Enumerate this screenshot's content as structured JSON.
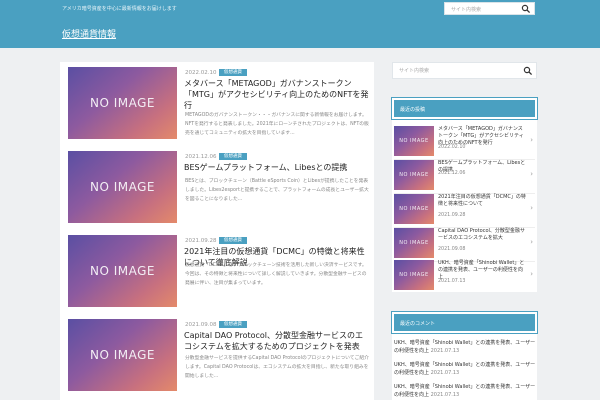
{
  "header": {
    "tagline": "アメリカ暗号資産を中心に最新情報をお届けします",
    "site_title": "仮想通貨情報",
    "search_placeholder": "サイト内検索"
  },
  "posts": [
    {
      "thumb_text": "NO IMAGE",
      "date": "2022.02.10",
      "category": "仮想通貨",
      "title": "メタバース「METAGOD」ガバナンストークン「MTG」がアクセシビリティ向上のためのNFTを発行",
      "excerpt": "METAGODのガバナンストークン・・・ガバナンスに関する新情報をお届けします。NFTを発行すると発表しました。2021年にローンチされたプロジェクトは、NFTの販売を通じてコミュニティの拡大を目指しています..."
    },
    {
      "thumb_text": "NO IMAGE",
      "date": "2021.12.06",
      "category": "仮想通貨",
      "title": "BESゲームプラットフォーム、Libesとの提携",
      "excerpt": "BESとは、ブロックチェーン（Battle eSports Coin）とLibesが提携したことを発表しました。Libes2esportと提携することで、プラットフォームの成長とユーザー拡大を図ることになりました..."
    },
    {
      "thumb_text": "NO IMAGE",
      "date": "2021.09.28",
      "category": "仮想通貨",
      "title": "2021年注目の仮想通貨「DCMC」の特徴と将来性について徹底解説",
      "excerpt": "仮想通貨「DCMC」は、ブロックチェーン技術を活用した新しい決済サービスです。今回は、その特徴と将来性について詳しく解説していきます。分散型金融サービスの発展に伴い、注目が集まっています。"
    },
    {
      "thumb_text": "NO IMAGE",
      "date": "2021.09.08",
      "category": "仮想通貨",
      "title": "Capital DAO Protocol、分散型金融サービスのエコシステムを拡大するためのプロジェクトを発表",
      "excerpt": "分散型金融サービスを提供するCapital DAO Protocolのプロジェクトについてご紹介します。Capital DAO Protocolは、エコシステムの拡大を目指し、新たな取り組みを開始しました..."
    }
  ],
  "sidebar": {
    "search_placeholder": "サイト内検索",
    "recent_heading": "最近の投稿",
    "recent": [
      {
        "thumb_text": "NO IMAGE",
        "title": "メタバース「METAGOD」ガバナンストークン「MTG」がアクセシビリティ向上のためのNFTを発行",
        "date": "2022.02.10"
      },
      {
        "thumb_text": "NO IMAGE",
        "title": "BESゲームプラットフォーム、Libesとの提携",
        "date": "2021.12.06"
      },
      {
        "thumb_text": "NO IMAGE",
        "title": "2021年注目の仮想通貨「DCMC」の特徴と将来性について",
        "date": "2021.09.28"
      },
      {
        "thumb_text": "NO IMAGE",
        "title": "Capital DAO Protocol、分散型金融サービスのエコシステムを拡大",
        "date": "2021.09.08"
      },
      {
        "thumb_text": "NO IMAGE",
        "title": "UKH、暗号資産「Shinobi Wallet」との連携を発表、ユーザーの利便性を向上",
        "date": "2021.07.13"
      }
    ],
    "second_heading": "最近のコメント",
    "second_items": [
      {
        "text": "UKH、暗号資産「Shinobi Wallet」との連携を発表、ユーザーの利便性を向上",
        "date": "2021.07.13"
      },
      {
        "text": "UKH、暗号資産「Shinobi Wallet」との連携を発表、ユーザーの利便性を向上",
        "date": "2021.07.13"
      },
      {
        "text": "UKH、暗号資産「Shinobi Wallet」との連携を発表、ユーザーの利便性を向上",
        "date": "2021.07.13"
      }
    ]
  },
  "colors": {
    "header": "#4aa0c1",
    "accent": "#4aa0c1",
    "background": "#eef0f2"
  }
}
